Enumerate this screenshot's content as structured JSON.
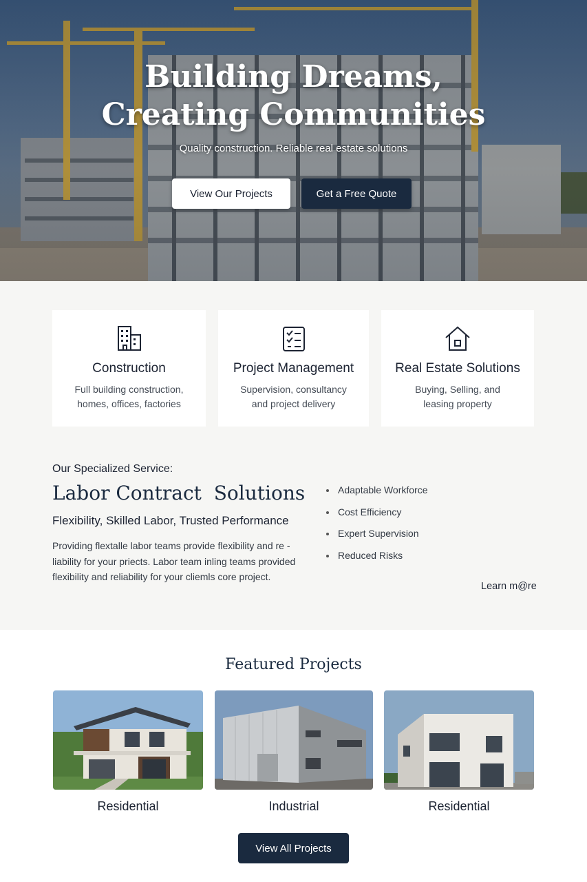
{
  "hero": {
    "title_line1": "Building Dreams,",
    "title_line2": "Creating Communities",
    "subtitle": "Quality construction. Reliable real estate solutions",
    "primary_button": "View Our Projects",
    "secondary_button": "Get a Free Quote"
  },
  "services": [
    {
      "icon": "building-icon",
      "title": "Construction",
      "line1": "Full building construction,",
      "line2": "homes, offices, factories"
    },
    {
      "icon": "checklist-icon",
      "title": "Project Management",
      "line1": "Supervision, consultancy",
      "line2": "and project delivery"
    },
    {
      "icon": "house-icon",
      "title": "Real Estate Solutions",
      "line1": "Buying, Selling, and",
      "line2": "leasing property"
    }
  ],
  "specialized": {
    "kicker": "Our Specialized Service:",
    "title": "Labor Contract  Solutions",
    "subtitle": "Flexibility, Skilled Labor, Trusted Performance",
    "body_line1": "Providing flextalle labor teams provide flexibility and re -",
    "body_line2": "liability for your priects. Labor team inling teams provided",
    "body_line3": "flexibility and reliability for your cliemls core project.",
    "bullets": [
      "Adaptable Workforce",
      "Cost Efficiency",
      "Expert Supervision",
      "Reduced Risks"
    ],
    "learn_more": "Learn m@re"
  },
  "featured": {
    "title": "Featured Projects",
    "projects": [
      {
        "label": "Residential"
      },
      {
        "label": "Industrial"
      },
      {
        "label": "Residential"
      }
    ],
    "view_all": "View All Projects"
  },
  "colors": {
    "navy": "#1a2a3f",
    "page_bg": "#f6f6f4",
    "card_bg": "#ffffff"
  }
}
